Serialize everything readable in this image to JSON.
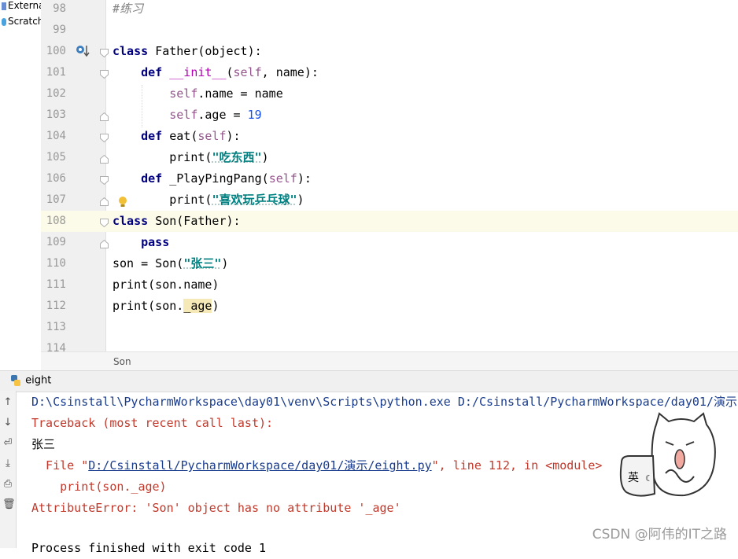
{
  "project_tree": {
    "items": [
      "External",
      "Scratche"
    ]
  },
  "editor": {
    "lines": [
      {
        "num": "98",
        "tokens": [
          {
            "t": "#练习",
            "c": "cmt"
          }
        ]
      },
      {
        "num": "99",
        "tokens": []
      },
      {
        "num": "100",
        "tokens": [
          {
            "t": "class ",
            "c": "kw"
          },
          {
            "t": "Father(",
            "c": ""
          },
          {
            "t": "object",
            "c": ""
          },
          {
            "t": "):",
            "c": ""
          }
        ]
      },
      {
        "num": "101",
        "tokens": [
          {
            "t": "    "
          },
          {
            "t": "def ",
            "c": "kw"
          },
          {
            "t": "__init__",
            "c": "magic"
          },
          {
            "t": "(",
            "c": ""
          },
          {
            "t": "self",
            "c": "self"
          },
          {
            "t": ", name):",
            "c": ""
          }
        ]
      },
      {
        "num": "102",
        "tokens": [
          {
            "t": "        "
          },
          {
            "t": "self",
            "c": "self"
          },
          {
            "t": ".name = name",
            "c": ""
          }
        ]
      },
      {
        "num": "103",
        "tokens": [
          {
            "t": "        "
          },
          {
            "t": "self",
            "c": "self"
          },
          {
            "t": ".age = ",
            "c": ""
          },
          {
            "t": "19",
            "c": "num"
          }
        ]
      },
      {
        "num": "104",
        "tokens": [
          {
            "t": "    "
          },
          {
            "t": "def ",
            "c": "kw"
          },
          {
            "t": "eat(",
            "c": ""
          },
          {
            "t": "self",
            "c": "self"
          },
          {
            "t": "):",
            "c": ""
          }
        ]
      },
      {
        "num": "105",
        "tokens": [
          {
            "t": "        "
          },
          {
            "t": "print(",
            "c": ""
          },
          {
            "t": "\"吃东西\"",
            "c": "str"
          },
          {
            "t": ")",
            "c": ""
          }
        ]
      },
      {
        "num": "106",
        "tokens": [
          {
            "t": "    "
          },
          {
            "t": "def ",
            "c": "kw"
          },
          {
            "t": "_PlayPingPang(",
            "c": ""
          },
          {
            "t": "self",
            "c": "self"
          },
          {
            "t": "):",
            "c": ""
          }
        ]
      },
      {
        "num": "107",
        "tokens": [
          {
            "t": "        "
          },
          {
            "t": "print(",
            "c": ""
          },
          {
            "t": "\"喜欢玩乒乓球\"",
            "c": "str"
          },
          {
            "t": ")",
            "c": ""
          }
        ]
      },
      {
        "num": "108",
        "tokens": [
          {
            "t": "class ",
            "c": "kw"
          },
          {
            "t": "Son(Father):",
            "c": ""
          }
        ]
      },
      {
        "num": "109",
        "tokens": [
          {
            "t": "    "
          },
          {
            "t": "pass",
            "c": "kw"
          }
        ]
      },
      {
        "num": "110",
        "tokens": [
          {
            "t": "son = Son(",
            "c": ""
          },
          {
            "t": "\"张三\"",
            "c": "str"
          },
          {
            "t": ")",
            "c": ""
          }
        ]
      },
      {
        "num": "111",
        "tokens": [
          {
            "t": "print(son.name)",
            "c": ""
          }
        ]
      },
      {
        "num": "112",
        "tokens": [
          {
            "t": "print(son.",
            "c": ""
          },
          {
            "t": "_age",
            "c": ""
          },
          {
            "t": ")",
            "c": ""
          }
        ]
      },
      {
        "num": "113",
        "tokens": []
      },
      {
        "num": "114",
        "tokens": []
      }
    ]
  },
  "breadcrumb": {
    "label": "Son"
  },
  "run": {
    "tab_label": "eight",
    "console": {
      "cmd": "D:\\Csinstall\\PycharmWorkspace\\day01\\venv\\Scripts\\python.exe D:/Csinstall/PycharmWorkspace/day01/演示",
      "traceback": "Traceback (most recent call last):",
      "output": "张三",
      "file_prefix": "  File \"",
      "file_link": "D:/Csinstall/PycharmWorkspace/day01/演示/eight.py",
      "file_suffix": "\", line 112, in <module>",
      "code_line": "    print(son._age)",
      "error": "AttributeError: 'Son' object has no attribute '_age'",
      "finish": "Process finished with exit code 1"
    }
  },
  "watermark": {
    "text": "CSDN @阿伟的IT之路"
  },
  "sticker": {
    "badge": "英"
  },
  "colors": {
    "keyword": "#000080",
    "self": "#94558d",
    "string": "#008080",
    "number": "#1750eb",
    "error": "#c0392b",
    "path": "#1a3c8c"
  }
}
